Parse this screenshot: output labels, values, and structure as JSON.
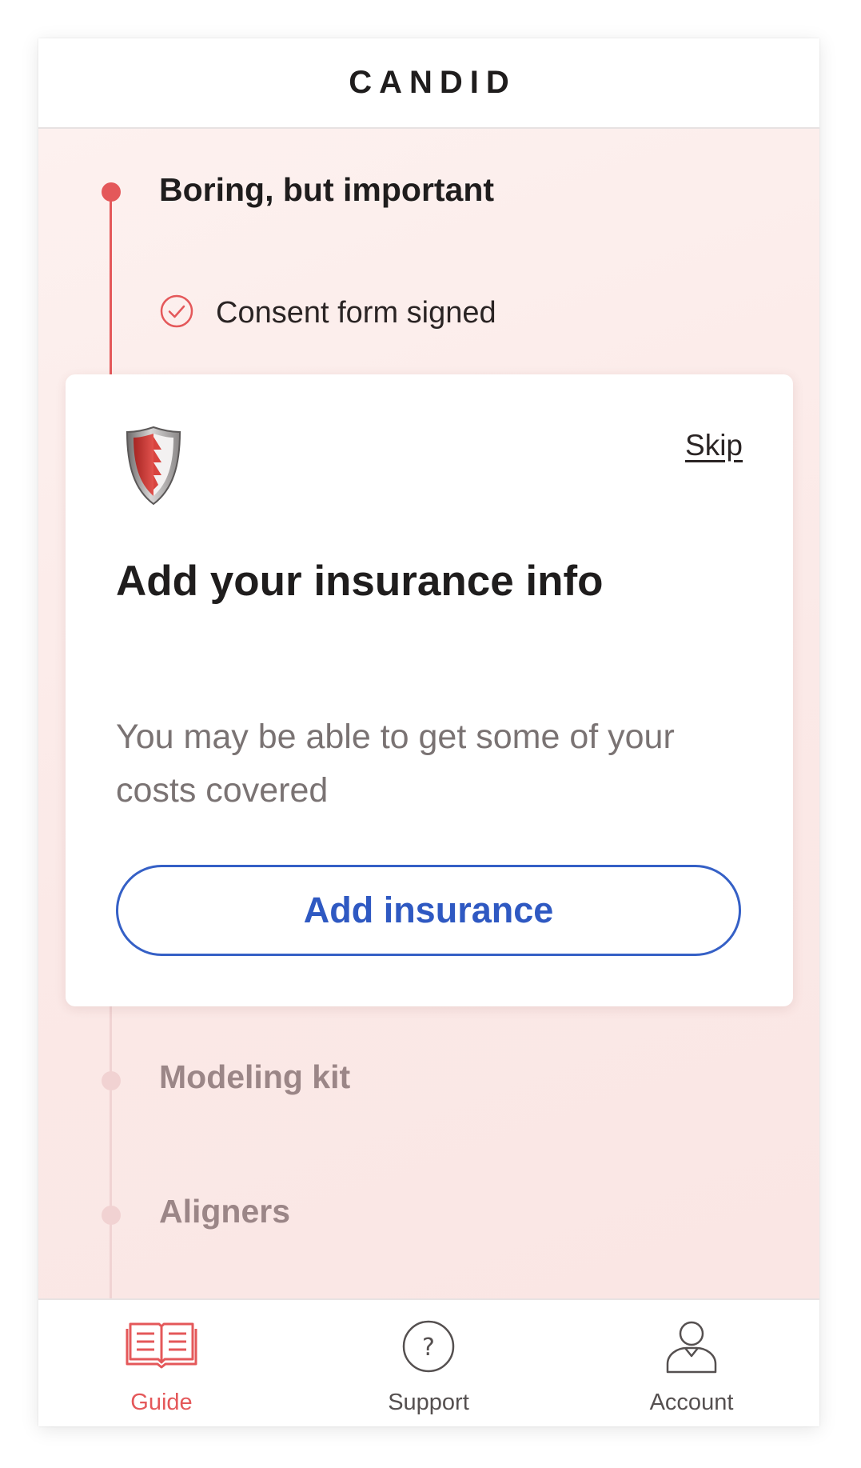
{
  "header": {
    "brand": "CANDID"
  },
  "timeline": {
    "current_step": {
      "title": "Boring, but important",
      "completed_item": "Consent form signed"
    },
    "upcoming_steps": [
      {
        "title": "Modeling kit"
      },
      {
        "title": "Aligners"
      }
    ]
  },
  "card": {
    "icon": "insurance-shield-icon",
    "skip_label": "Skip",
    "title": "Add your insurance info",
    "body": "You may be able to get some of your costs covered",
    "button_label": "Add insurance"
  },
  "bottom_nav": {
    "items": [
      {
        "label": "Guide",
        "icon": "book-icon",
        "active": true
      },
      {
        "label": "Support",
        "icon": "question-icon",
        "active": false
      },
      {
        "label": "Account",
        "icon": "user-icon",
        "active": false
      }
    ]
  },
  "colors": {
    "accent": "#e4585a",
    "button": "#3560c6",
    "faded": "#9b8687",
    "background": "#fbe9e7"
  }
}
